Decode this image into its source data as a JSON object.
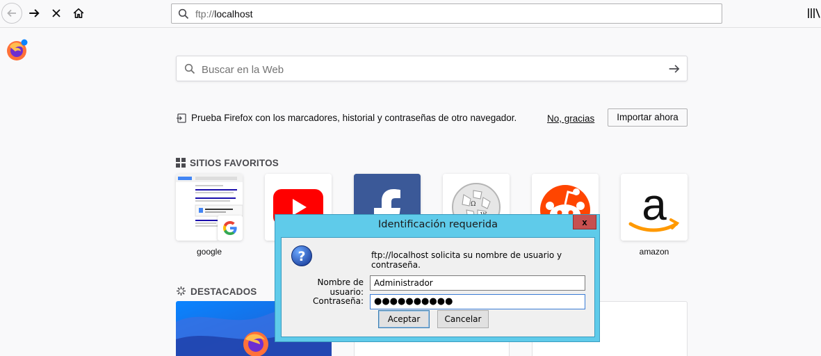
{
  "toolbar": {
    "url_prefix": "ftp://",
    "url_host": "localhost"
  },
  "newtab": {
    "search_placeholder": "Buscar en la Web",
    "import_message": "Prueba Firefox con los marcadores, historial y contraseñas de otro navegador.",
    "no_thanks": "No, gracias",
    "import_button": "Importar ahora",
    "topsites_title": "SITIOS FAVORITOS",
    "highlights_title": "DESTACADOS",
    "topsites": [
      {
        "label": "google"
      },
      {
        "label": ""
      },
      {
        "label": ""
      },
      {
        "label": ""
      },
      {
        "label": ""
      },
      {
        "label": "amazon"
      }
    ]
  },
  "dialog": {
    "title": "Identificación requerida",
    "close": "x",
    "message": "ftp://localhost solicita su nombre de usuario y contraseña.",
    "username_label": "Nombre de usuario:",
    "username_value": "Administrador",
    "password_label": "Contraseña:",
    "password_mask": "●●●●●●●●●●",
    "ok_button": "Aceptar",
    "cancel_button": "Cancelar"
  },
  "colors": {
    "dialog_frame": "#5fcbea",
    "close_button": "#c75050",
    "youtube_red": "#ff0000",
    "facebook_blue": "#3b5998",
    "reddit_orange": "#ff4500",
    "amazon_orange": "#ff9900"
  }
}
